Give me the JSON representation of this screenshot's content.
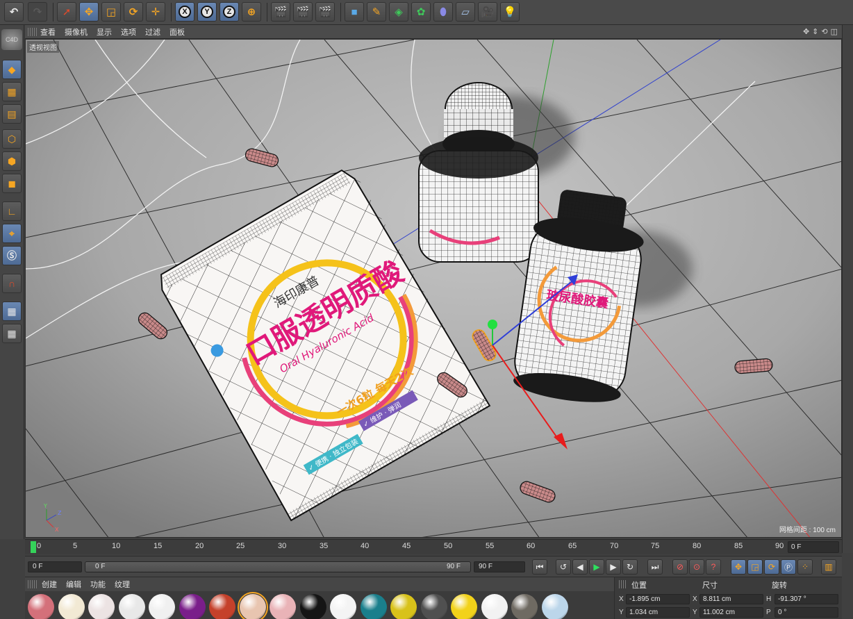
{
  "toolbar": {
    "undo_icon": "undo-icon",
    "redo_icon": "redo-icon",
    "axis_x": "X",
    "axis_y": "Y",
    "axis_z": "Z"
  },
  "viewport": {
    "menu": [
      "查看",
      "摄像机",
      "显示",
      "选项",
      "过滤",
      "面板"
    ],
    "label": "透视视图",
    "grid_info": "网格间距 : 100 cm",
    "axis_labels": {
      "y": "Y",
      "z": "Z",
      "x": "X"
    },
    "pouch_texts": {
      "brand": "海印康普",
      "title": "口服透明质酸",
      "subtitle": "Oral Hyaluronic Acid",
      "dose": "一次6粒 每天2次",
      "tag1": "✓ 维护 · 弹润",
      "tag2": "✓ 便携 · 独立包装"
    },
    "bottle_text": "玻尿酸胶囊"
  },
  "timeline": {
    "ticks": [
      "0",
      "5",
      "10",
      "15",
      "20",
      "25",
      "30",
      "35",
      "40",
      "45",
      "50",
      "55",
      "60",
      "65",
      "70",
      "75",
      "80",
      "85",
      "90"
    ],
    "current_frame": "0 F"
  },
  "transport": {
    "start_field": "0 F",
    "range_start": "0 F",
    "range_end": "90 F",
    "end_field": "90 F"
  },
  "materials": {
    "menu": [
      "创建",
      "编辑",
      "功能",
      "纹理"
    ],
    "balls": [
      {
        "name": "pink-material",
        "color": "#d4707a"
      },
      {
        "name": "label-material",
        "color": "#f2e9d4"
      },
      {
        "name": "label-material-2",
        "color": "#ece3e3"
      },
      {
        "name": "white-material",
        "color": "#e8e8e8"
      },
      {
        "name": "white-material-2",
        "color": "#f0f0f0"
      },
      {
        "name": "purple-material",
        "color": "#7a1e8a"
      },
      {
        "name": "red-material",
        "color": "#c5412b"
      },
      {
        "name": "skin-material",
        "color": "#e8c5b0"
      },
      {
        "name": "light-pink-material",
        "color": "#e9b3b7"
      },
      {
        "name": "black-material",
        "color": "#151515"
      },
      {
        "name": "white-material-3",
        "color": "#f4f4f4"
      },
      {
        "name": "teal-material",
        "color": "#1a7f8c"
      },
      {
        "name": "yellow-label-material",
        "color": "#d8c21a"
      },
      {
        "name": "gray-material",
        "color": "#505050"
      },
      {
        "name": "yellow-material",
        "color": "#f2d21a"
      },
      {
        "name": "white-material-4",
        "color": "#f2f2f2"
      },
      {
        "name": "hdri-material",
        "color": "#6f6a62"
      },
      {
        "name": "light-blue-material",
        "color": "#bcd6ea"
      }
    ]
  },
  "coords": {
    "headers": {
      "position": "位置",
      "size": "尺寸",
      "rotation": "旋转"
    },
    "rows": [
      {
        "axis1": "X",
        "pos": "-1.895 cm",
        "axis2": "X",
        "size": "8.811 cm",
        "axis3": "H",
        "rot": "-91.307 °"
      },
      {
        "axis1": "Y",
        "pos": "1.034 cm",
        "axis2": "Y",
        "size": "11.002 cm",
        "axis3": "P",
        "rot": "0 °"
      }
    ]
  },
  "colors": {
    "accent": "#f6a623",
    "active_blue": "#4d6a94",
    "playhead_green": "#35d35a"
  }
}
